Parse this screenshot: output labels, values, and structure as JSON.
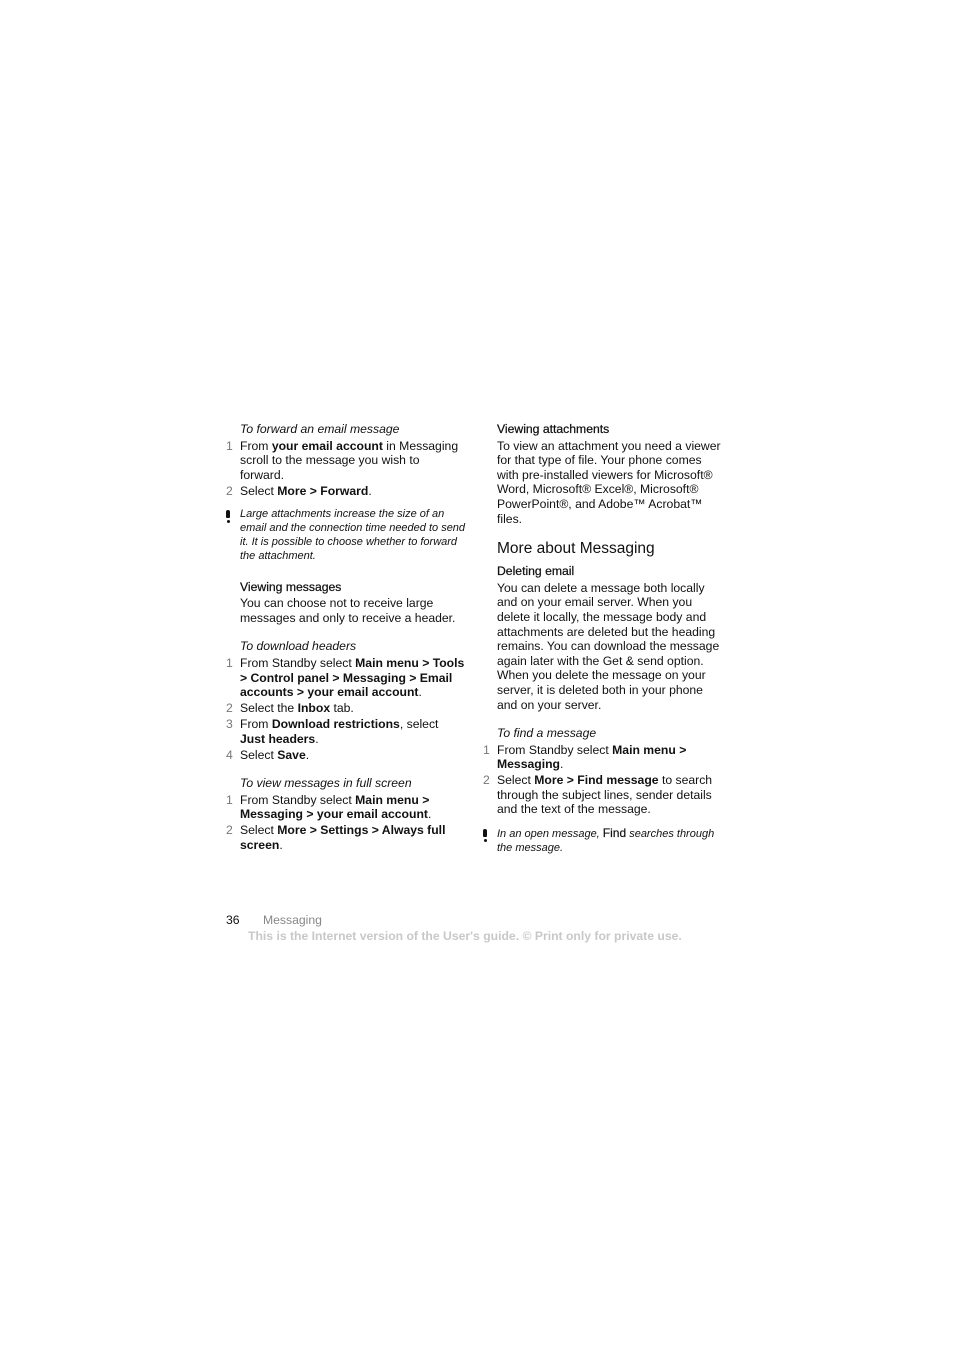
{
  "left_column": {
    "forward": {
      "title": "To forward an email message",
      "steps": [
        {
          "num": "1",
          "parts": [
            [
              "From ",
              false
            ],
            [
              "your email account",
              true
            ],
            [
              " in Messaging scroll to the message you wish to forward.",
              false
            ]
          ]
        },
        {
          "num": "2",
          "parts": [
            [
              "Select ",
              false
            ],
            [
              "More > Forward",
              true
            ],
            [
              ".",
              false
            ]
          ]
        }
      ],
      "note_parts": [
        [
          "Large attachments increase the size of an email and the connection time needed to send it. It is possible to choose whether to forward the attachment.",
          false
        ]
      ]
    },
    "viewing_messages": {
      "heading": "Viewing messages",
      "body": "You can choose not to receive large messages and only to receive a header."
    },
    "download_headers": {
      "title": "To download headers",
      "steps": [
        {
          "num": "1",
          "parts": [
            [
              "From Standby select ",
              false
            ],
            [
              "Main menu > Tools > Control panel > Messaging > Email accounts > your email account",
              true
            ],
            [
              ".",
              false
            ]
          ]
        },
        {
          "num": "2",
          "parts": [
            [
              "Select the ",
              false
            ],
            [
              "Inbox",
              true
            ],
            [
              " tab.",
              false
            ]
          ]
        },
        {
          "num": "3",
          "parts": [
            [
              "From ",
              false
            ],
            [
              "Download restrictions",
              true
            ],
            [
              ", select ",
              false
            ],
            [
              "Just headers",
              true
            ],
            [
              ".",
              false
            ]
          ]
        },
        {
          "num": "4",
          "parts": [
            [
              "Select ",
              false
            ],
            [
              "Save",
              true
            ],
            [
              ".",
              false
            ]
          ]
        }
      ]
    },
    "full_screen": {
      "title": "To view messages in full screen",
      "steps": [
        {
          "num": "1",
          "parts": [
            [
              "From Standby select ",
              false
            ],
            [
              "Main menu > Messaging > your email account",
              true
            ],
            [
              ".",
              false
            ]
          ]
        },
        {
          "num": "2",
          "parts": [
            [
              "Select ",
              false
            ],
            [
              "More > Settings > Always full screen",
              true
            ],
            [
              ".",
              false
            ]
          ]
        }
      ]
    }
  },
  "right_column": {
    "viewing_attachments": {
      "heading": "Viewing attachments",
      "body": "To view an attachment you need a viewer for that type of file. Your phone comes with pre-installed viewers for Microsoft® Word, Microsoft® Excel®, Microsoft® PowerPoint®, and Adobe™ Acrobat™ files."
    },
    "more_about": {
      "heading": "More about Messaging"
    },
    "deleting_email": {
      "heading": "Deleting email",
      "body": "You can delete a message both locally and on your email server. When you delete it locally, the message body and attachments are deleted but the heading remains. You can download the message again later with the Get & send option. When you delete the message on your server, it is deleted both in your phone and on your server."
    },
    "find_message": {
      "title": "To find a message",
      "steps": [
        {
          "num": "1",
          "parts": [
            [
              "From Standby select ",
              false
            ],
            [
              "Main menu > Messaging",
              true
            ],
            [
              ".",
              false
            ]
          ]
        },
        {
          "num": "2",
          "parts": [
            [
              "Select ",
              false
            ],
            [
              "More > Find message",
              true
            ],
            [
              " to search through the subject lines, sender details and the text of the message.",
              false
            ]
          ]
        }
      ],
      "note_parts": [
        [
          "In an open message, ",
          false
        ],
        [
          "Find",
          true
        ],
        [
          " searches through the message.",
          false
        ]
      ]
    }
  },
  "footer": {
    "page_number": "36",
    "section": "Messaging",
    "watermark": "This is the Internet version of the User's guide. © Print only for private use."
  },
  "icons": {
    "note": "exclamation-note-icon"
  }
}
